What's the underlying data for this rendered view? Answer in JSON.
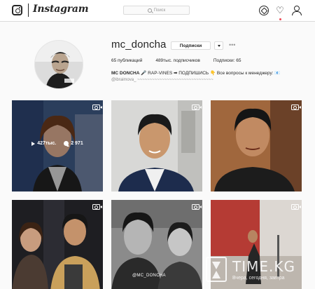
{
  "app": {
    "wordmark": "Instagram"
  },
  "search": {
    "placeholder": "Поиск"
  },
  "nav": {
    "icons": [
      "compass-icon",
      "heart-icon",
      "person-icon"
    ],
    "notification_color": "#ed4956"
  },
  "profile": {
    "username": "mc_doncha",
    "follow_label": "Подписки",
    "posts": "65 публикаций",
    "followers": "489тыс. подписчиков",
    "following": "Подписки: 65",
    "bio_name": "MC DONCHA",
    "bio_text": "🎤 RAP-VINES ➡ ПОДПИШИСЬ 👇 Все вопросы к менеджеру: 📧",
    "bio_link": "@ibraimova_ ~~~~~~~~~~~~~~~~~~~~~~~~~~~~~~~"
  },
  "posts": [
    {
      "type": "video",
      "hover": true,
      "views": "427тыс.",
      "comments": "2 971"
    },
    {
      "type": "video"
    },
    {
      "type": "video"
    },
    {
      "type": "video"
    },
    {
      "type": "video",
      "caption": "@MC_DONCHA"
    },
    {
      "type": "video"
    }
  ],
  "watermark": {
    "title": "TIME.KG",
    "subtitle": "Вчера, сегодня, завтра"
  }
}
